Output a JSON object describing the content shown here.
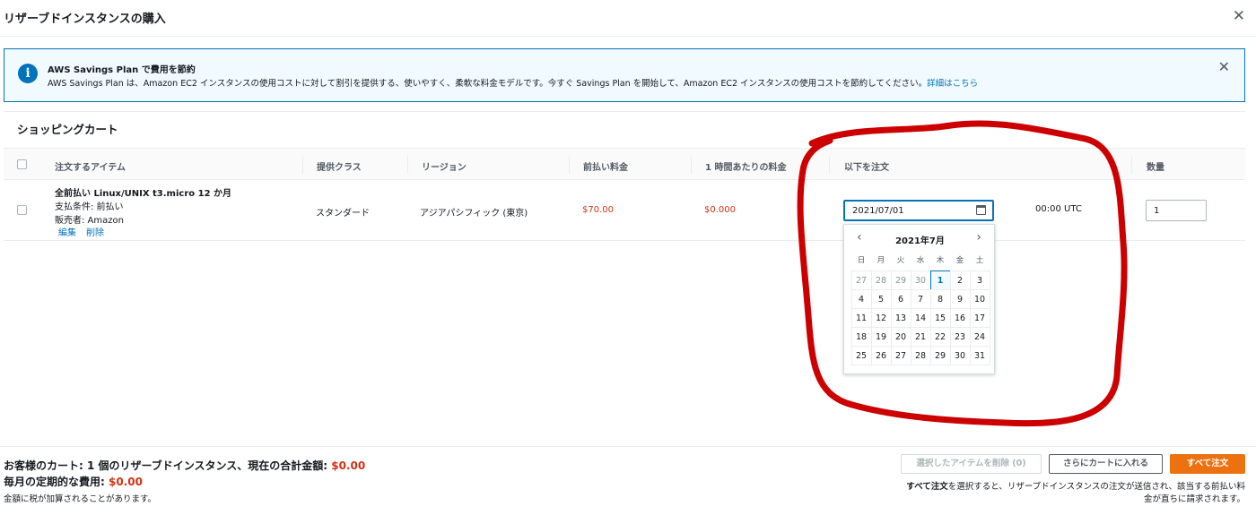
{
  "modal": {
    "title": "リザーブドインスタンスの購入",
    "close": "✕"
  },
  "banner": {
    "title": "AWS Savings Plan で費用を節約",
    "text": "AWS Savings Plan は、Amazon EC2 インスタンスの使用コストに対して割引を提供する、使いやすく、柔軟な料金モデルです。今すぐ Savings Plan を開始して、Amazon EC2 インスタンスの使用コストを節約してください。",
    "link": "詳細はこちら",
    "icon": "info-icon",
    "close": "✕"
  },
  "cart": {
    "title": "ショッピングカート",
    "columns": {
      "item": "注文するアイテム",
      "offering_class": "提供クラス",
      "region": "リージョン",
      "upfront": "前払い料金",
      "hourly": "1 時間あたりの料金",
      "order_at": "以下を注文",
      "quantity": "数量"
    },
    "row": {
      "item_name": "全前払い Linux/UNIX t3.micro 12 か月",
      "payment": "支払条件: 前払い",
      "seller": "販売者: Amazon",
      "edit": "編集",
      "delete": "削除",
      "offering_class": "スタンダード",
      "region": "アジアパシフィック (東京)",
      "upfront": "$70.00",
      "hourly": "$0.000",
      "date": "2021/07/01",
      "time": "00:00 UTC",
      "quantity": "1"
    }
  },
  "calendar": {
    "month_label": "2021年7月",
    "prev": "‹",
    "next": "›",
    "weekdays": [
      "日",
      "月",
      "火",
      "水",
      "木",
      "金",
      "土"
    ],
    "days": [
      [
        "27",
        "28",
        "29",
        "30",
        "1",
        "2",
        "3"
      ],
      [
        "4",
        "5",
        "6",
        "7",
        "8",
        "9",
        "10"
      ],
      [
        "11",
        "12",
        "13",
        "14",
        "15",
        "16",
        "17"
      ],
      [
        "18",
        "19",
        "20",
        "21",
        "22",
        "23",
        "24"
      ],
      [
        "25",
        "26",
        "27",
        "28",
        "29",
        "30",
        "31"
      ]
    ],
    "muted_first_row_count": 4,
    "selected": "1"
  },
  "footer": {
    "cart_summary": "お客様のカート: 1 個のリザーブドインスタンス、現在の合計金額: ",
    "cart_total": "$0.00",
    "monthly_label": "毎月の定期的な費用: ",
    "monthly_total": "$0.00",
    "tax_note": "金額に税が加算されることがあります。",
    "btn_delete_selected": "選択したアイテムを削除 (0)",
    "btn_add_more": "さらにカートに入れる",
    "btn_order_all": "すべて注文",
    "note_bold": "すべて注文",
    "note_rest": "を選択すると、リザーブドインスタンスの注文が送信され、該当する前払い料金が直ちに請求されます。"
  },
  "colors": {
    "accent": "#0073bb",
    "price": "#d13212",
    "primary_button": "#ec7211",
    "annotation": "#cc0000"
  }
}
